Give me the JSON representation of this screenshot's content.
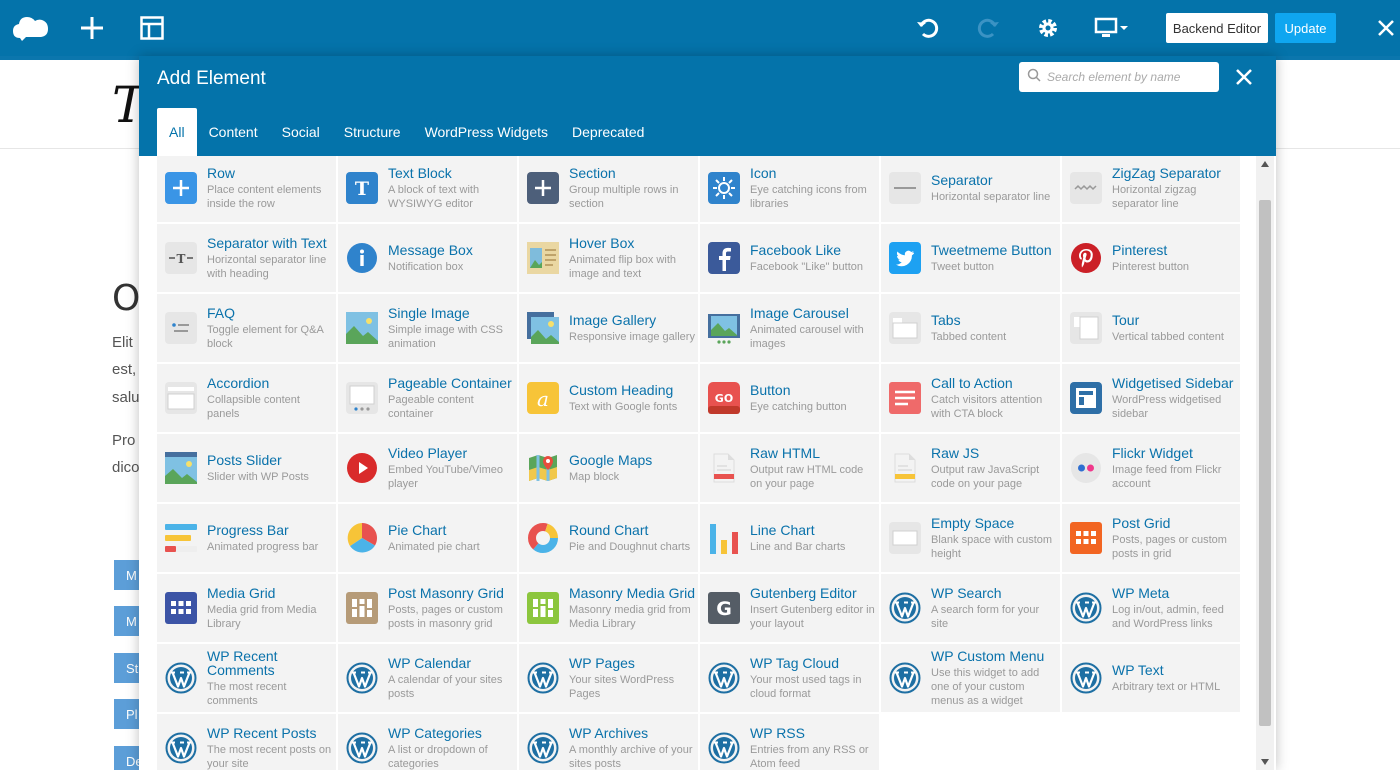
{
  "toolbar": {
    "backend_label": "Backend Editor",
    "update_label": "Update",
    "colors": {
      "bar": "#0473aa",
      "update": "#0fa6f0"
    }
  },
  "background": {
    "title_fragment": "Th",
    "heading_fragment": "OU",
    "text_lines": [
      "Elit",
      "est,",
      "salu",
      "Pro",
      "dico"
    ],
    "buttons": [
      "M",
      "M",
      "St",
      "Pl",
      "De"
    ]
  },
  "modal": {
    "title": "Add Element",
    "search_placeholder": "Search element by name",
    "tabs": [
      {
        "label": "All",
        "active": true
      },
      {
        "label": "Content",
        "active": false
      },
      {
        "label": "Social",
        "active": false
      },
      {
        "label": "Structure",
        "active": false
      },
      {
        "label": "WordPress Widgets",
        "active": false
      },
      {
        "label": "Deprecated",
        "active": false
      }
    ]
  },
  "elements": [
    {
      "name": "Row",
      "desc": "Place content elements inside the row",
      "icon": "plus-icon"
    },
    {
      "name": "Text Block",
      "desc": "A block of text with WYSIWYG editor",
      "icon": "text-t-icon"
    },
    {
      "name": "Section",
      "desc": "Group multiple rows in section",
      "icon": "plus-icon"
    },
    {
      "name": "Icon",
      "desc": "Eye catching icons from libraries",
      "icon": "sun-icon"
    },
    {
      "name": "Separator",
      "desc": "Horizontal separator line",
      "icon": "separator-icon"
    },
    {
      "name": "ZigZag Separator",
      "desc": "Horizontal zigzag separator line",
      "icon": "zigzag-icon"
    },
    {
      "name": "Separator with Text",
      "desc": "Horizontal separator line with heading",
      "icon": "separator-text-icon"
    },
    {
      "name": "Message Box",
      "desc": "Notification box",
      "icon": "info-icon"
    },
    {
      "name": "Hover Box",
      "desc": "Animated flip box with image and text",
      "icon": "hover-box-icon"
    },
    {
      "name": "Facebook Like",
      "desc": "Facebook \"Like\" button",
      "icon": "facebook-icon"
    },
    {
      "name": "Tweetmeme Button",
      "desc": "Tweet button",
      "icon": "twitter-icon"
    },
    {
      "name": "Pinterest",
      "desc": "Pinterest button",
      "icon": "pinterest-icon"
    },
    {
      "name": "FAQ",
      "desc": "Toggle element for Q&A block",
      "icon": "faq-icon"
    },
    {
      "name": "Single Image",
      "desc": "Simple image with CSS animation",
      "icon": "image-icon"
    },
    {
      "name": "Image Gallery",
      "desc": "Responsive image gallery",
      "icon": "gallery-icon"
    },
    {
      "name": "Image Carousel",
      "desc": "Animated carousel with images",
      "icon": "carousel-icon"
    },
    {
      "name": "Tabs",
      "desc": "Tabbed content",
      "icon": "tabs-icon"
    },
    {
      "name": "Tour",
      "desc": "Vertical tabbed content",
      "icon": "tour-icon"
    },
    {
      "name": "Accordion",
      "desc": "Collapsible content panels",
      "icon": "accordion-icon"
    },
    {
      "name": "Pageable Container",
      "desc": "Pageable content container",
      "icon": "pageable-icon"
    },
    {
      "name": "Custom Heading",
      "desc": "Text with Google fonts",
      "icon": "heading-a-icon"
    },
    {
      "name": "Button",
      "desc": "Eye catching button",
      "icon": "button-go-icon"
    },
    {
      "name": "Call to Action",
      "desc": "Catch visitors attention with CTA block",
      "icon": "cta-icon"
    },
    {
      "name": "Widgetised Sidebar",
      "desc": "WordPress widgetised sidebar",
      "icon": "sidebar-icon"
    },
    {
      "name": "Posts Slider",
      "desc": "Slider with WP Posts",
      "icon": "posts-slider-icon"
    },
    {
      "name": "Video Player",
      "desc": "Embed YouTube/Vimeo player",
      "icon": "play-icon"
    },
    {
      "name": "Google Maps",
      "desc": "Map block",
      "icon": "map-icon"
    },
    {
      "name": "Raw HTML",
      "desc": "Output raw HTML code on your page",
      "icon": "raw-html-icon"
    },
    {
      "name": "Raw JS",
      "desc": "Output raw JavaScript code on your page",
      "icon": "raw-js-icon"
    },
    {
      "name": "Flickr Widget",
      "desc": "Image feed from Flickr account",
      "icon": "flickr-icon"
    },
    {
      "name": "Progress Bar",
      "desc": "Animated progress bar",
      "icon": "progress-bar-icon"
    },
    {
      "name": "Pie Chart",
      "desc": "Animated pie chart",
      "icon": "pie-chart-icon"
    },
    {
      "name": "Round Chart",
      "desc": "Pie and Doughnut charts",
      "icon": "round-chart-icon"
    },
    {
      "name": "Line Chart",
      "desc": "Line and Bar charts",
      "icon": "line-chart-icon"
    },
    {
      "name": "Empty Space",
      "desc": "Blank space with custom height",
      "icon": "empty-space-icon"
    },
    {
      "name": "Post Grid",
      "desc": "Posts, pages or custom posts in grid",
      "icon": "post-grid-icon"
    },
    {
      "name": "Media Grid",
      "desc": "Media grid from Media Library",
      "icon": "media-grid-icon"
    },
    {
      "name": "Post Masonry Grid",
      "desc": "Posts, pages or custom posts in masonry grid",
      "icon": "masonry-grid-icon"
    },
    {
      "name": "Masonry Media Grid",
      "desc": "Masonry media grid from Media Library",
      "icon": "masonry-media-icon"
    },
    {
      "name": "Gutenberg Editor",
      "desc": "Insert Gutenberg editor in your layout",
      "icon": "gutenberg-icon"
    },
    {
      "name": "WP Search",
      "desc": "A search form for your site",
      "icon": "wordpress-icon"
    },
    {
      "name": "WP Meta",
      "desc": "Log in/out, admin, feed and WordPress links",
      "icon": "wordpress-icon"
    },
    {
      "name": "WP Recent Comments",
      "desc": "The most recent comments",
      "icon": "wordpress-icon"
    },
    {
      "name": "WP Calendar",
      "desc": "A calendar of your sites posts",
      "icon": "wordpress-icon"
    },
    {
      "name": "WP Pages",
      "desc": "Your sites WordPress Pages",
      "icon": "wordpress-icon"
    },
    {
      "name": "WP Tag Cloud",
      "desc": "Your most used tags in cloud format",
      "icon": "wordpress-icon"
    },
    {
      "name": "WP Custom Menu",
      "desc": "Use this widget to add one of your custom menus as a widget",
      "icon": "wordpress-icon"
    },
    {
      "name": "WP Text",
      "desc": "Arbitrary text or HTML",
      "icon": "wordpress-icon"
    },
    {
      "name": "WP Recent Posts",
      "desc": "The most recent posts on your site",
      "icon": "wordpress-icon"
    },
    {
      "name": "WP Categories",
      "desc": "A list or dropdown of categories",
      "icon": "wordpress-icon"
    },
    {
      "name": "WP Archives",
      "desc": "A monthly archive of your sites posts",
      "icon": "wordpress-icon"
    },
    {
      "name": "WP RSS",
      "desc": "Entries from any RSS or Atom feed",
      "icon": "wordpress-icon"
    }
  ]
}
